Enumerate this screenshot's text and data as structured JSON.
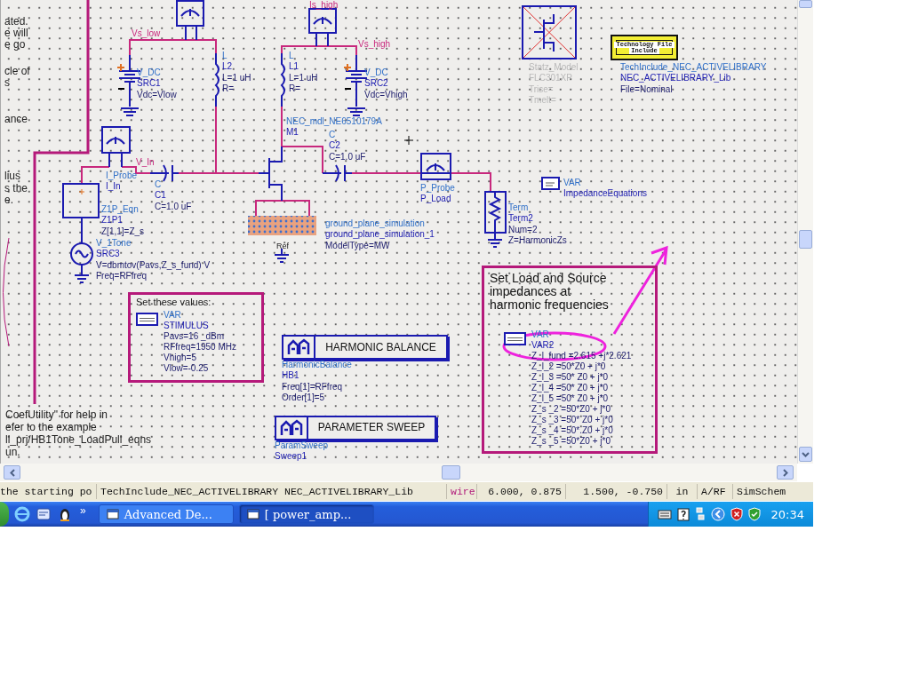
{
  "schematic": {
    "side_note": [
      "ated.",
      "e will",
      "e go",
      "cle of",
      "s",
      "ance",
      "lius",
      "s the",
      "e."
    ],
    "bottom_note": [
      "CoefUtility\" for help in",
      "efer to the example",
      "ll_prj/HB1Tone_LoadPull_eqns",
      "un."
    ],
    "components": [
      {
        "kind": "net",
        "lines": [
          "Is_high"
        ]
      },
      {
        "kind": "net",
        "lines": [
          "Vs_low"
        ]
      },
      {
        "kind": "net",
        "lines": [
          "Vs_high"
        ]
      },
      {
        "kind": "part",
        "lines": [
          "L",
          "L2",
          "L=1 uH",
          "R="
        ],
        "disabled": false
      },
      {
        "kind": "part",
        "lines": [
          "L",
          "L1",
          "L=1 uH",
          "R="
        ],
        "disabled": false
      },
      {
        "kind": "part",
        "lines": [
          "V_DC",
          "SRC1",
          "Vdc=Vlow"
        ],
        "disabled": false
      },
      {
        "kind": "part",
        "lines": [
          "V_DC",
          "SRC2",
          "Vdc=Vhigh"
        ],
        "disabled": false
      },
      {
        "kind": "part",
        "lines": [
          "Statz_Model",
          "FLC301XP",
          "Trise=",
          "Tmelt="
        ],
        "disabled": true
      },
      {
        "kind": "part",
        "lines": [
          "TechInclude_NEC_ACTIVELIBRARY",
          "NEC_ACTIVELIBRARY_Lib",
          "File=Nominal"
        ],
        "disabled": false
      },
      {
        "kind": "part",
        "lines": [
          "NEC_mdl_NE6510179A",
          "M1"
        ],
        "disabled": false
      },
      {
        "kind": "part",
        "lines": [
          "C",
          "C2",
          "C=1.0 uF"
        ],
        "disabled": false
      },
      {
        "kind": "net",
        "lines": [
          "V_In"
        ]
      },
      {
        "kind": "part",
        "lines": [
          "I_Probe",
          "I_In"
        ],
        "disabled": false
      },
      {
        "kind": "part",
        "lines": [
          "C",
          "C1",
          "C=1.0 uF"
        ],
        "disabled": false
      },
      {
        "kind": "part",
        "lines": [
          "P_Probe",
          "P_Load"
        ],
        "disabled": false
      },
      {
        "kind": "part",
        "lines": [
          "VAR",
          "ImpedanceEquations"
        ],
        "disabled": false
      },
      {
        "kind": "part",
        "lines": [
          "Z1P_Eqn",
          "Z1P1",
          "Z[1,1]=Z_s"
        ],
        "disabled": false
      },
      {
        "kind": "part",
        "lines": [
          "Term",
          "Term2",
          "Num=2",
          "Z=HarmonicZs"
        ],
        "disabled": false
      },
      {
        "kind": "ref",
        "lines": [
          "Ref"
        ]
      },
      {
        "kind": "part",
        "lines": [
          "ground_plane_simulation",
          "ground_plane_simulation_1",
          "ModelType=MW"
        ],
        "disabled": false
      },
      {
        "kind": "part",
        "lines": [
          "V_1Tone",
          "SRC3",
          "V=dbmtov(Pavs,Z_s_fund) V",
          "Freq=RFfreq"
        ],
        "disabled": false
      }
    ],
    "tech_file_box": [
      "Technology File",
      "Include"
    ],
    "stimulus_note": {
      "title": "Set these values:",
      "lines": [
        "VAR",
        "STIMULUS",
        "Pavs=16 _dBm",
        "RFfreq=1950 MHz",
        "Vhigh=5",
        "Vlow=-0.25"
      ]
    },
    "harmonic_note": {
      "title": "Set Load and Source impedances at harmonic frequencies",
      "lines": [
        "VAR",
        "VAR2",
        "Z_l_fund =2.615 +j*2.621",
        "Z_l_2 =50*Z0 + j*0",
        "Z_l_3 =50* Z0 + j*0",
        "Z_l_4 =50* Z0 + j*0",
        "Z_l_5 =50* Z0 + j*0",
        "Z_s _2 =50*Z0 + j*0",
        "Z_s _3 =50* Z0 + j*0",
        "Z_s _4 =50*.Z0 + j*0",
        "Z_s _5 =50*Z0 + j*0"
      ]
    },
    "controllers": [
      {
        "label": "HARMONIC BALANCE",
        "lines": [
          "HarmonicBalance",
          "HB1",
          "Freq[1]=RFfreq",
          "Order[1]=5"
        ]
      },
      {
        "label": "PARAMETER SWEEP",
        "lines": [
          "ParamSweep",
          "Sweep1"
        ]
      }
    ]
  },
  "status_bar": {
    "hint": "the starting po",
    "library": "TechInclude_NEC_ACTIVELIBRARY NEC_ACTIVELIBRARY_Lib",
    "mode": "wire",
    "coords": "6.000, 0.875",
    "delta": "1.500, -0.750",
    "units": "in",
    "domain": "A/RF",
    "window": "SimSchem"
  },
  "taskbar": {
    "chevron": "»",
    "tasks": [
      {
        "label": "Advanced De...",
        "selected": false
      },
      {
        "label": "[ power_amp...",
        "selected": true
      }
    ],
    "clock": "20:34"
  }
}
